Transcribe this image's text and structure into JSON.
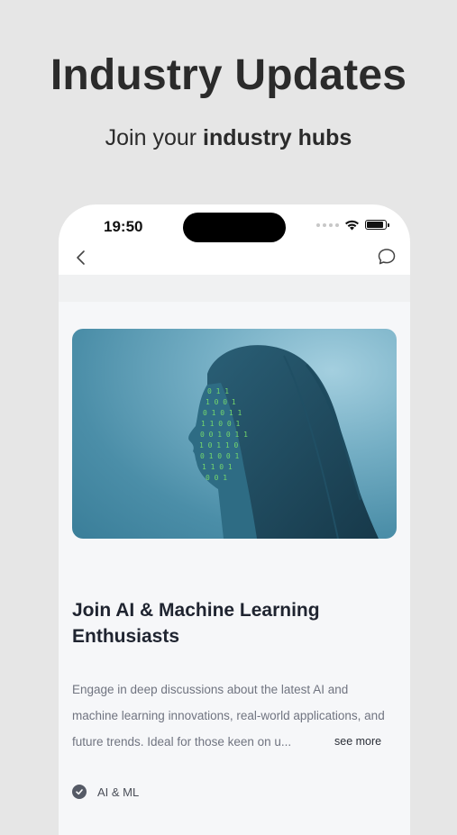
{
  "promo": {
    "headline": "Industry Updates",
    "subhead_prefix": "Join your ",
    "subhead_bold": "industry hubs"
  },
  "status_bar": {
    "time": "19:50",
    "icons": [
      "signal-dots-icon",
      "wifi-icon",
      "battery-icon"
    ]
  },
  "nav": {
    "back_icon": "chevron-left-icon",
    "action_icon": "chat-bubble-icon"
  },
  "card": {
    "image_icon": "ai-face-illustration",
    "title": "Join AI & Machine Learning Enthusiasts",
    "description": "Engage in deep discussions about the latest AI and machine learning innovations, real-world applications, and future trends. Ideal for those keen on u...",
    "see_more": "see more",
    "tag": "AI & ML"
  },
  "colors": {
    "background": "#e6e6e6",
    "title": "#1f2430",
    "description": "#707480",
    "hero_blue": "#4b8ea8",
    "code_green": "#7be26b"
  }
}
